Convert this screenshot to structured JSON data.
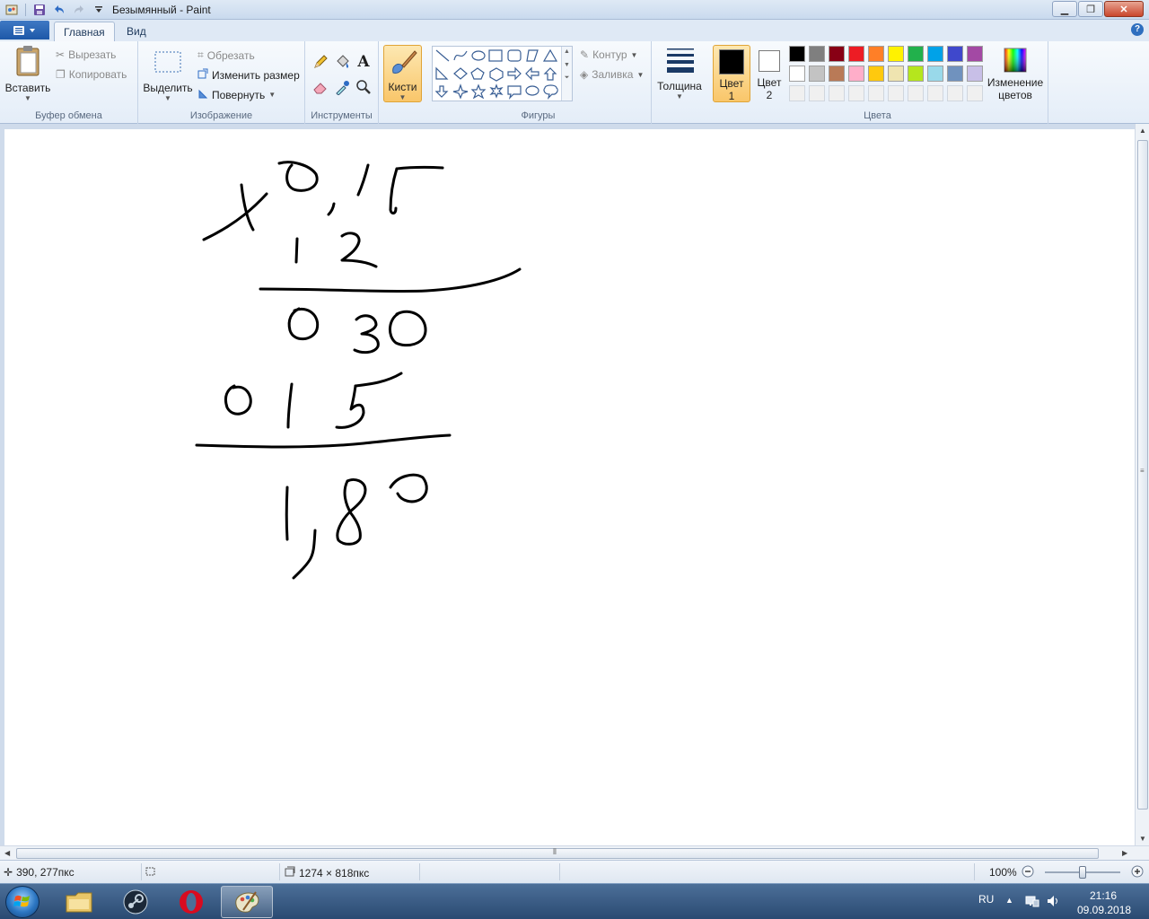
{
  "window": {
    "title": "Безымянный - Paint",
    "minimize": "▁",
    "maximize": "❐",
    "close": "✕"
  },
  "tabs": [
    {
      "label": "Главная",
      "active": true
    },
    {
      "label": "Вид",
      "active": false
    }
  ],
  "help": "?",
  "ribbon": {
    "clipboard": {
      "label": "Буфер обмена",
      "paste": "Вставить",
      "cut": "Вырезать",
      "copy": "Копировать"
    },
    "image": {
      "label": "Изображение",
      "select": "Выделить",
      "crop": "Обрезать",
      "resize": "Изменить размер",
      "rotate": "Повернуть"
    },
    "tools": {
      "label": "Инструменты"
    },
    "brushes": {
      "label": "Кисти"
    },
    "shapes": {
      "label": "Фигуры",
      "outline": "Контур",
      "fill": "Заливка"
    },
    "size": {
      "label": "Толщина"
    },
    "colors": {
      "label": "Цвета",
      "color1_line1": "Цвет",
      "color1_line2": "1",
      "color2_line1": "Цвет",
      "color2_line2": "2",
      "color1_value": "#000000",
      "color2_value": "#ffffff",
      "edit_line1": "Изменение",
      "edit_line2": "цветов",
      "palette_row1": [
        "#000000",
        "#7f7f7f",
        "#880015",
        "#ed1c24",
        "#ff7f27",
        "#fff200",
        "#22b14c",
        "#00a2e8",
        "#3f48cc",
        "#a349a4"
      ],
      "palette_row2": [
        "#ffffff",
        "#c3c3c3",
        "#b97a57",
        "#ffaec9",
        "#ffc90e",
        "#efe4b0",
        "#b5e61d",
        "#99d9ea",
        "#7092be",
        "#c8bfe7"
      ],
      "palette_row3": [
        "#f0f0f0",
        "#f0f0f0",
        "#f0f0f0",
        "#f0f0f0",
        "#f0f0f0",
        "#f0f0f0",
        "#f0f0f0",
        "#f0f0f0",
        "#f0f0f0",
        "#f0f0f0"
      ]
    }
  },
  "status": {
    "cursor_pos": "390, 277пкс",
    "image_size": "1274 × 818пкс",
    "zoom": "100%",
    "zoom_level": 0.5
  },
  "taskbar": {
    "language": "RU",
    "time": "21:16",
    "date": "09.09.2018"
  }
}
